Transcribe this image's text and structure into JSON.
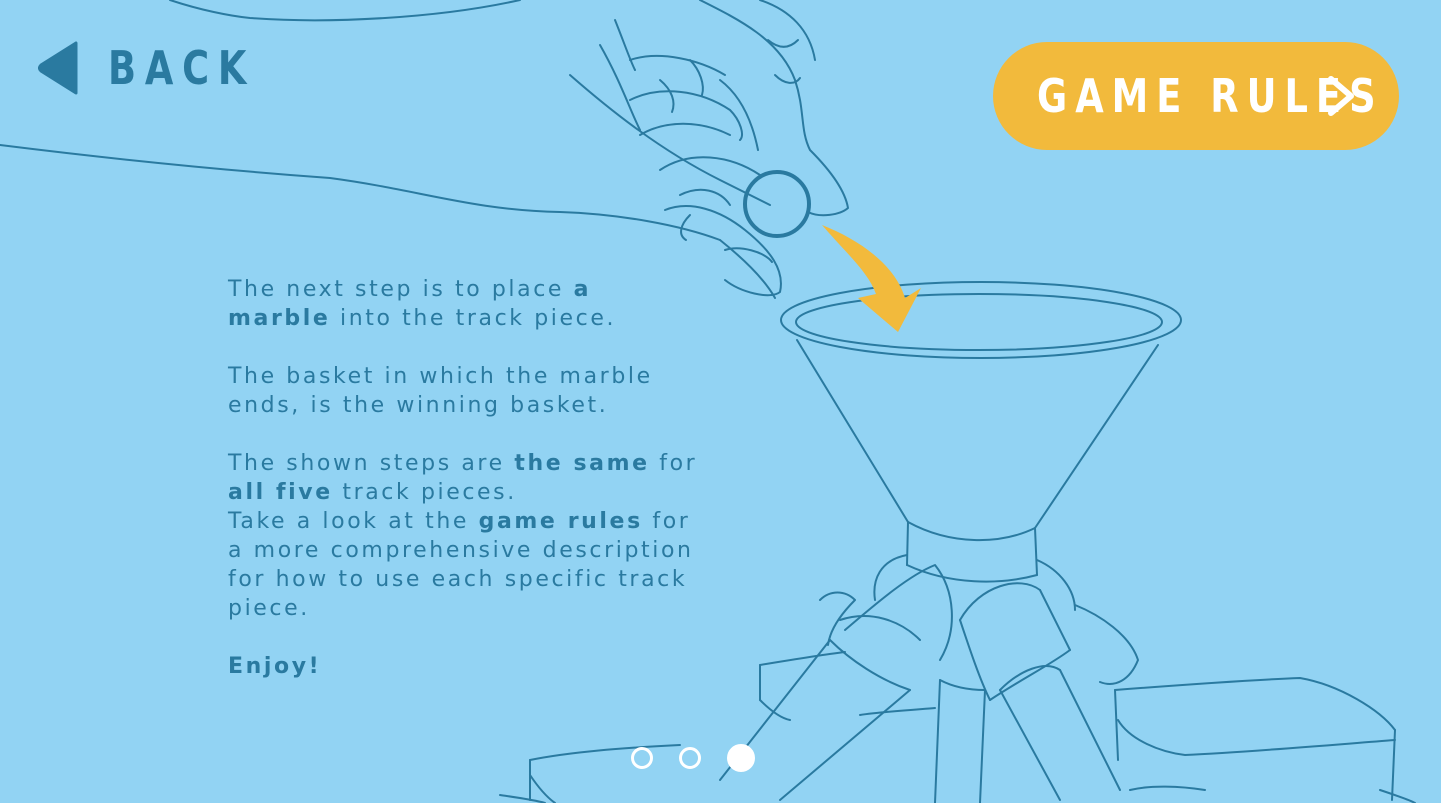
{
  "nav": {
    "back_label": "BACK",
    "back_icon": "triangle-left-icon",
    "rules_label": "GAME RULES",
    "rules_icon": "chevron-right-icon"
  },
  "instructions": {
    "p1_a": "The next step is to place ",
    "p1_b": "a marble",
    "p1_c": " into the track piece.",
    "p2": "The basket in which the marble ends, is the winning basket.",
    "p3_a": "The shown steps are ",
    "p3_b": "the same",
    "p3_c": " for ",
    "p3_d": "all five",
    "p3_e": " track pieces.",
    "p4_a": "Take a look at the ",
    "p4_b": "game rules",
    "p4_c": " for a more comprehensive description for how to use each specific track piece.",
    "p5": "Enjoy!"
  },
  "pager": {
    "total": 3,
    "current": 3
  },
  "colors": {
    "background": "#92d3f3",
    "ink": "#2a7aa0",
    "accent": "#f2ba3c",
    "white": "#ffffff"
  }
}
